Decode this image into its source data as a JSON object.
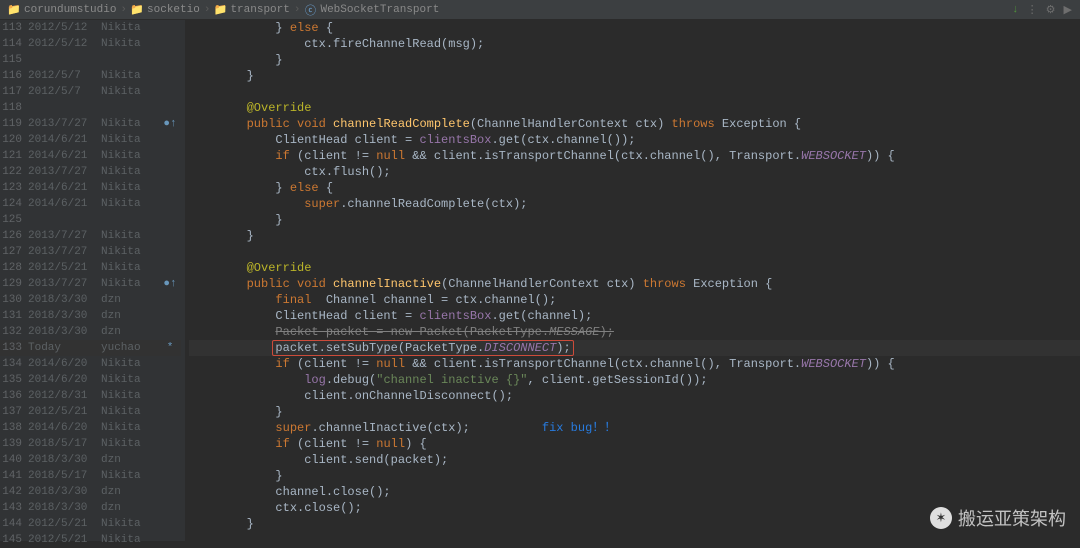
{
  "breadcrumb": {
    "items": [
      "corundumstudio",
      "socketio",
      "transport",
      "WebSocketTransport"
    ]
  },
  "toolbar": {
    "download_arrow": "↓",
    "spacer": "⋮",
    "gear": "⚙",
    "play": "▶"
  },
  "gutter": [
    {
      "ln": 113,
      "date": "2012/5/12",
      "author": "Nikita",
      "mark": ""
    },
    {
      "ln": 114,
      "date": "2012/5/12",
      "author": "Nikita",
      "mark": ""
    },
    {
      "ln": 115,
      "date": "",
      "author": "",
      "mark": ""
    },
    {
      "ln": 116,
      "date": "2012/5/7",
      "author": "Nikita",
      "mark": ""
    },
    {
      "ln": 117,
      "date": "2012/5/7",
      "author": "Nikita",
      "mark": ""
    },
    {
      "ln": 118,
      "date": "",
      "author": "",
      "mark": ""
    },
    {
      "ln": 119,
      "date": "2013/7/27",
      "author": "Nikita",
      "mark": "●↑"
    },
    {
      "ln": 120,
      "date": "2014/6/21",
      "author": "Nikita",
      "mark": ""
    },
    {
      "ln": 121,
      "date": "2014/6/21",
      "author": "Nikita",
      "mark": ""
    },
    {
      "ln": 122,
      "date": "2013/7/27",
      "author": "Nikita",
      "mark": ""
    },
    {
      "ln": 123,
      "date": "2014/6/21",
      "author": "Nikita",
      "mark": ""
    },
    {
      "ln": 124,
      "date": "2014/6/21",
      "author": "Nikita",
      "mark": ""
    },
    {
      "ln": 125,
      "date": "",
      "author": "",
      "mark": ""
    },
    {
      "ln": 126,
      "date": "2013/7/27",
      "author": "Nikita",
      "mark": ""
    },
    {
      "ln": 127,
      "date": "2013/7/27",
      "author": "Nikita",
      "mark": ""
    },
    {
      "ln": 128,
      "date": "2012/5/21",
      "author": "Nikita",
      "mark": ""
    },
    {
      "ln": 129,
      "date": "2013/7/27",
      "author": "Nikita",
      "mark": "●↑"
    },
    {
      "ln": 130,
      "date": "2018/3/30",
      "author": "dzn",
      "mark": ""
    },
    {
      "ln": 131,
      "date": "2018/3/30",
      "author": "dzn",
      "mark": ""
    },
    {
      "ln": 132,
      "date": "2018/3/30",
      "author": "dzn",
      "mark": ""
    },
    {
      "ln": 133,
      "date": "Today",
      "author": "yuchao",
      "mark": "*"
    },
    {
      "ln": 134,
      "date": "2014/6/20",
      "author": "Nikita",
      "mark": ""
    },
    {
      "ln": 135,
      "date": "2014/6/20",
      "author": "Nikita",
      "mark": ""
    },
    {
      "ln": 136,
      "date": "2012/8/31",
      "author": "Nikita",
      "mark": ""
    },
    {
      "ln": 137,
      "date": "2012/5/21",
      "author": "Nikita",
      "mark": ""
    },
    {
      "ln": 138,
      "date": "2014/6/20",
      "author": "Nikita",
      "mark": ""
    },
    {
      "ln": 139,
      "date": "2018/5/17",
      "author": "Nikita",
      "mark": ""
    },
    {
      "ln": 140,
      "date": "2018/3/30",
      "author": "dzn",
      "mark": ""
    },
    {
      "ln": 141,
      "date": "2018/5/17",
      "author": "Nikita",
      "mark": ""
    },
    {
      "ln": 142,
      "date": "2018/3/30",
      "author": "dzn",
      "mark": ""
    },
    {
      "ln": 143,
      "date": "2018/3/30",
      "author": "dzn",
      "mark": ""
    },
    {
      "ln": 144,
      "date": "2012/5/21",
      "author": "Nikita",
      "mark": ""
    },
    {
      "ln": 145,
      "date": "2012/5/21",
      "author": "Nikita",
      "mark": ""
    }
  ],
  "code": {
    "l113": "            } else {",
    "l114": "                ctx.fireChannelRead(msg);",
    "l115": "            }",
    "l116": "        }",
    "l117": "",
    "l118": "        @Override",
    "l119": "        public void channelReadComplete(ChannelHandlerContext ctx) throws Exception {",
    "l120": "            ClientHead client = clientsBox.get(ctx.channel());",
    "l121": "            if (client != null && client.isTransportChannel(ctx.channel(), Transport.WEBSOCKET)) {",
    "l122": "                ctx.flush();",
    "l123": "            } else {",
    "l124": "                super.channelReadComplete(ctx);",
    "l125": "            }",
    "l126": "        }",
    "l127": "",
    "l128": "        @Override",
    "l129": "        public void channelInactive(ChannelHandlerContext ctx) throws Exception {",
    "l130": "            final  Channel channel = ctx.channel();",
    "l131": "            ClientHead client = clientsBox.get(channel);",
    "l132": "            Packet packet = new Packet(PacketType.MESSAGE);",
    "l133": "            packet.setSubType(PacketType.DISCONNECT);",
    "l134": "            if (client != null && client.isTransportChannel(ctx.channel(), Transport.WEBSOCKET)) {",
    "l135": "                log.debug(\"channel inactive {}\", client.getSessionId());",
    "l136": "                client.onChannelDisconnect();",
    "l137": "            }",
    "l138_a": "            super.channelInactive(ctx);",
    "l138_b": "fix bug！！",
    "l139": "            if (client != null) {",
    "l140": "                client.send(packet);",
    "l141": "            }",
    "l142": "            channel.close();",
    "l143": "            ctx.close();",
    "l144": "        }",
    "l145": ""
  },
  "watermark": {
    "text": "搬运亚策架构"
  }
}
